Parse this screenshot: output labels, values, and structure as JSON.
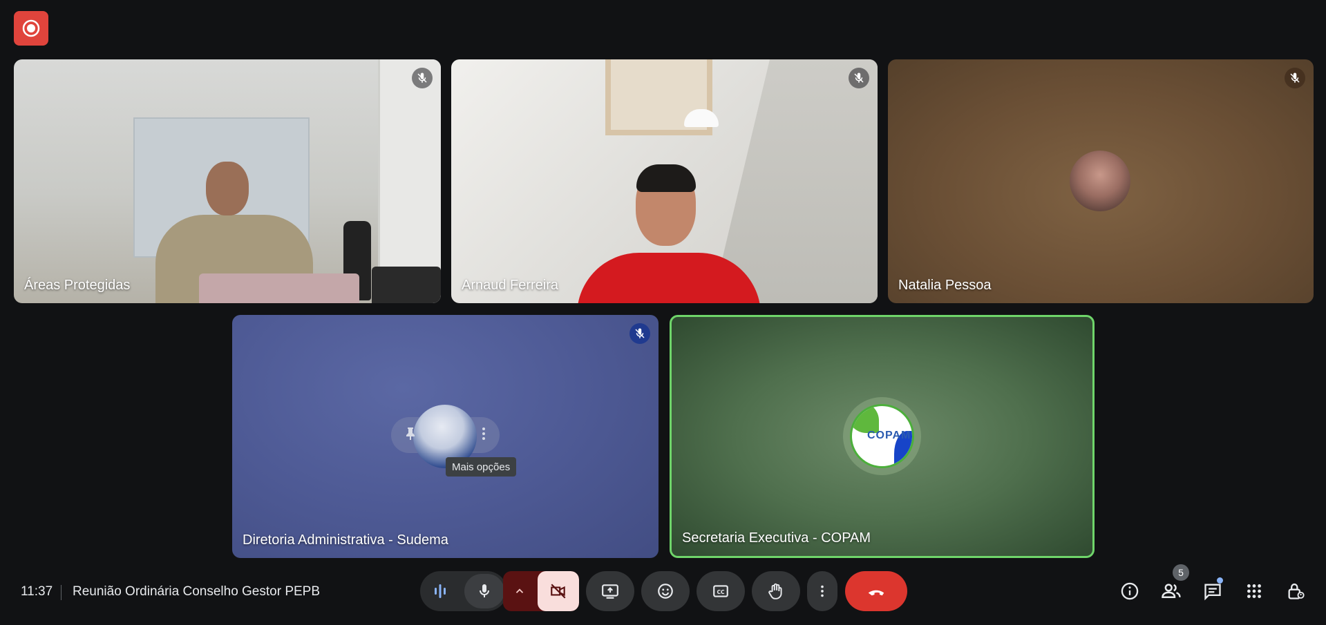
{
  "recording": {
    "icon": "record-icon"
  },
  "tiles": [
    {
      "name": "Áreas Protegidas",
      "muted": true
    },
    {
      "name": "Arnaud Ferreira",
      "muted": true
    },
    {
      "name": "Natalia Pessoa",
      "muted": true
    },
    {
      "name": "Diretoria Administrativa - Sudema",
      "muted": true,
      "tooltip": "Mais opções"
    },
    {
      "name": "Secretaria Executiva - COPAM",
      "muted": false,
      "speaking": true,
      "logo_text": "COPAM"
    }
  ],
  "bottom_bar": {
    "time": "11:37",
    "meeting_title": "Reunião Ordinária Conselho Gestor PEPB",
    "people_count": "5"
  },
  "colors": {
    "background": "#111214",
    "hangup": "#dc362e",
    "speaking_border": "#6fd56a",
    "recording": "#e0443c"
  }
}
